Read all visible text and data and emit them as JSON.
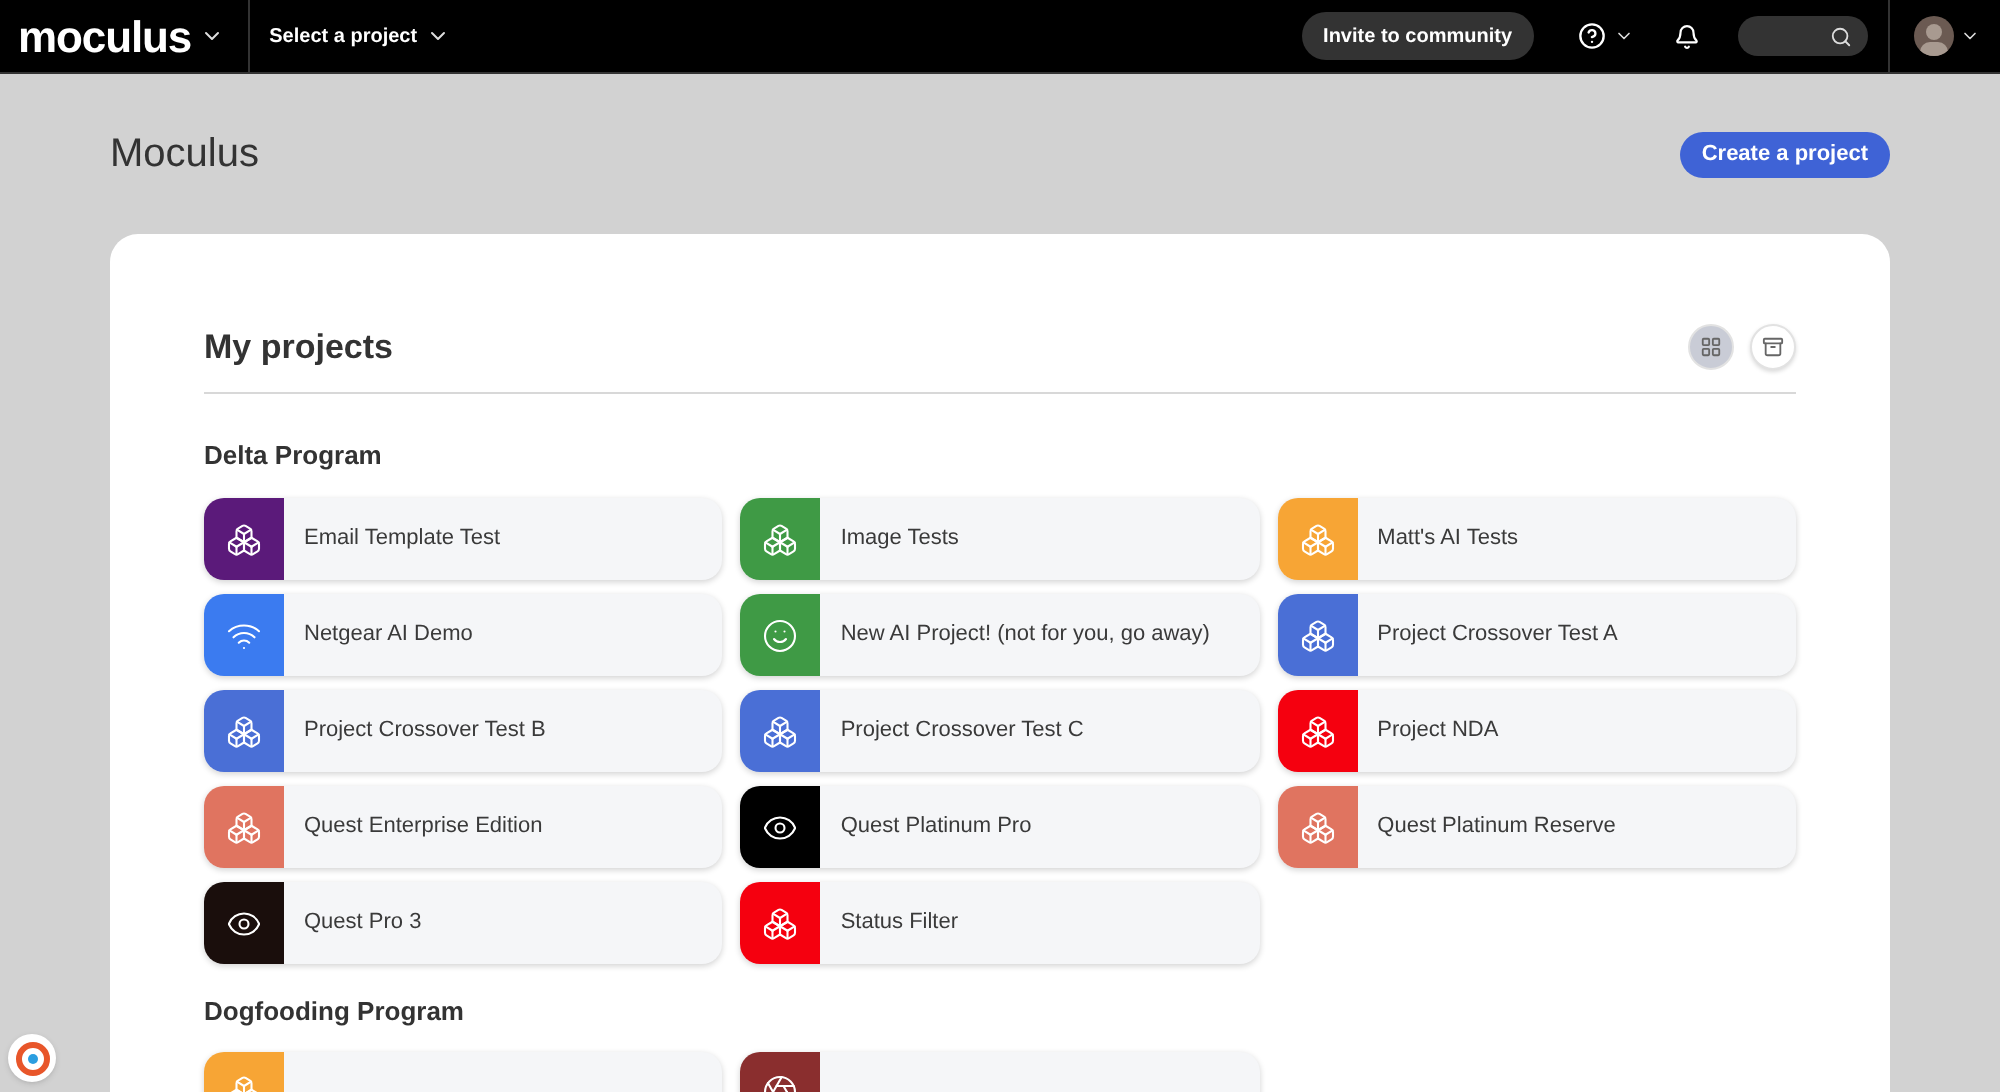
{
  "navbar": {
    "logo": "moculus",
    "project_select": "Select a project",
    "invite_button": "Invite to community"
  },
  "page": {
    "title": "Moculus",
    "create_button": "Create a project"
  },
  "projects_panel": {
    "title": "My projects",
    "view_toggles": [
      {
        "kind": "grid",
        "selected": true
      },
      {
        "kind": "archive",
        "selected": false
      }
    ],
    "groups": [
      {
        "name": "Delta Program",
        "projects": [
          {
            "name": "Email Template Test",
            "kind": "cubes",
            "color": "#5b1a7a"
          },
          {
            "name": "Image Tests",
            "kind": "cubes",
            "color": "#3f9a45"
          },
          {
            "name": "Matt's AI Tests",
            "kind": "cubes",
            "color": "#f7a535"
          },
          {
            "name": "Netgear AI Demo",
            "kind": "wifi",
            "color": "#3b7bf0"
          },
          {
            "name": "New AI Project! (not for you, go away)",
            "kind": "smile",
            "color": "#3f9a45"
          },
          {
            "name": "Project Crossover Test A",
            "kind": "cubes",
            "color": "#4a6fd6"
          },
          {
            "name": "Project Crossover Test B",
            "kind": "cubes",
            "color": "#4a6fd6"
          },
          {
            "name": "Project Crossover Test C",
            "kind": "cubes",
            "color": "#4a6fd6"
          },
          {
            "name": "Project NDA",
            "kind": "cubes",
            "color": "#f5000f"
          },
          {
            "name": "Quest Enterprise Edition",
            "kind": "cubes",
            "color": "#e07460"
          },
          {
            "name": "Quest Platinum Pro",
            "kind": "eye",
            "color": "#000000"
          },
          {
            "name": "Quest Platinum Reserve",
            "kind": "cubes",
            "color": "#e07460"
          },
          {
            "name": "Quest Pro 3",
            "kind": "eye",
            "color": "#1a0e0c"
          },
          {
            "name": "Status Filter",
            "kind": "cubes",
            "color": "#f5000f"
          }
        ]
      },
      {
        "name": "Dogfooding Program",
        "projects": [
          {
            "kind": "cubes",
            "color": "#f7a535"
          },
          {
            "kind": "wheel",
            "color": "#8a2e2e"
          }
        ]
      }
    ]
  }
}
